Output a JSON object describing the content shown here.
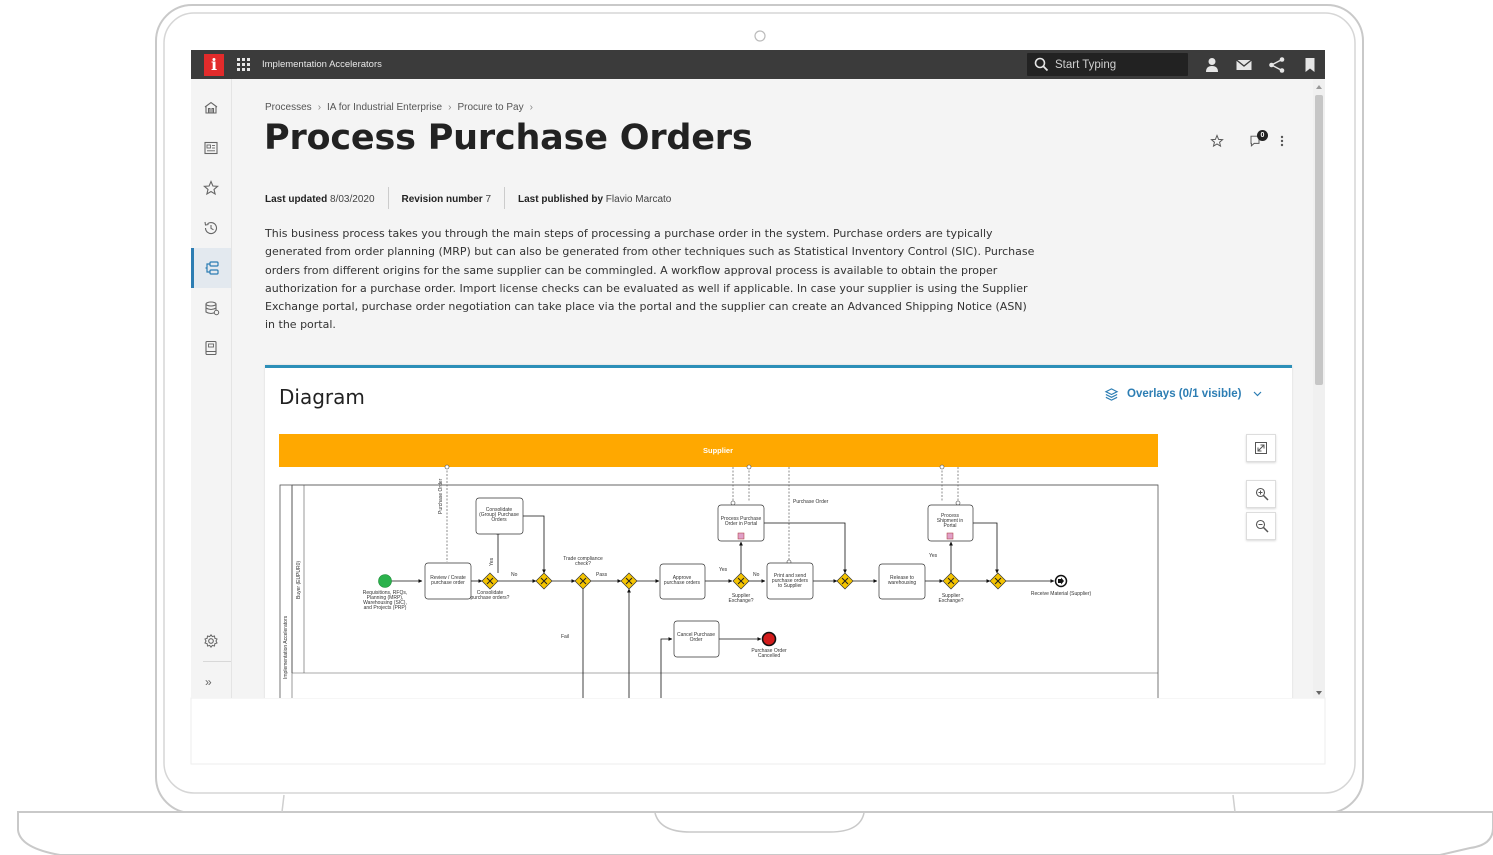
{
  "topbar": {
    "logo_letter": "i",
    "app_title": "Implementation Accelerators",
    "search_placeholder": "Start Typing",
    "icons": [
      "user-icon",
      "mail-icon",
      "share-icon",
      "bookmark-icon"
    ]
  },
  "rail": {
    "icons": [
      "home-icon",
      "dashboard-icon",
      "star-icon",
      "history-icon",
      "process-icon",
      "data-icon",
      "book-icon",
      "settings-icon",
      "expand-icon"
    ],
    "active": "process-icon",
    "expand_label": "»"
  },
  "breadcrumb": [
    "Processes",
    "IA for Industrial Enterprise",
    "Procure to Pay"
  ],
  "breadcrumb_sep": "›",
  "page": {
    "title": "Process Purchase Orders",
    "last_updated_label": "Last updated",
    "last_updated": "8/03/2020",
    "revision_label": "Revision number",
    "revision": "7",
    "published_label": "Last published by",
    "published_by": "Flavio Marcato",
    "description": "This business process takes you through the main steps of processing a purchase order in the system. Purchase orders are typically generated from order planning (MRP) but can also be generated from other techniques such as Statistical Inventory Control (SIC). Purchase orders from different origins for the same supplier can be commingled. A workflow approval process is available to obtain the proper authorization for a purchase order. Import license checks can be evaluated as well if applicable. In case your supplier is using the Supplier Exchange portal, purchase order negotiation can take place via the portal and the supplier can create an Advanced Shipping Notice (ASN) in the portal.",
    "comment_count": "0"
  },
  "diagram": {
    "title": "Diagram",
    "overlays_label": "Overlays (0/1 visible)",
    "pool_supplier": "Supplier",
    "pool_main": "Implementation Accelerators",
    "lane_buyer": "Buyer (EUPUR0)",
    "labels": {
      "start": "Requisitions, RFQs, Planning (MRP), Warehousing (SIC), and Projects (PRP)",
      "review": "Review / Create purchase order",
      "consolidate": "Consolidate (Group) Purchase Orders",
      "consolidate_q": "Consolidate purchase orders?",
      "yes": "Yes",
      "no": "No",
      "trade": "Trade compliance check?",
      "pass": "Pass",
      "fail": "Fail",
      "approve": "Approve purchase orders",
      "supplier_exchange_q": "Supplier Exchange?",
      "process_po_portal": "Process Purchase Order in Portal",
      "print_send": "Print and send purchase orders to Supplier",
      "purchase_order": "Purchase Order",
      "release": "Release to warehousing",
      "process_shipment": "Process Shipment in Portal",
      "receive": "Receive Material (Supplier)",
      "cancel": "Cancel Purchase Order",
      "cancelled": "Purchase Order Cancelled",
      "purchase_order_flow": "Purchase Order"
    }
  },
  "colors": {
    "accent": "#2c7db3",
    "supplier_pool": "#ffa800",
    "gateway": "#f5c400",
    "start_event": "#2bb24c",
    "end_cancel": "#d21c1c",
    "logo": "#e22b2b"
  }
}
